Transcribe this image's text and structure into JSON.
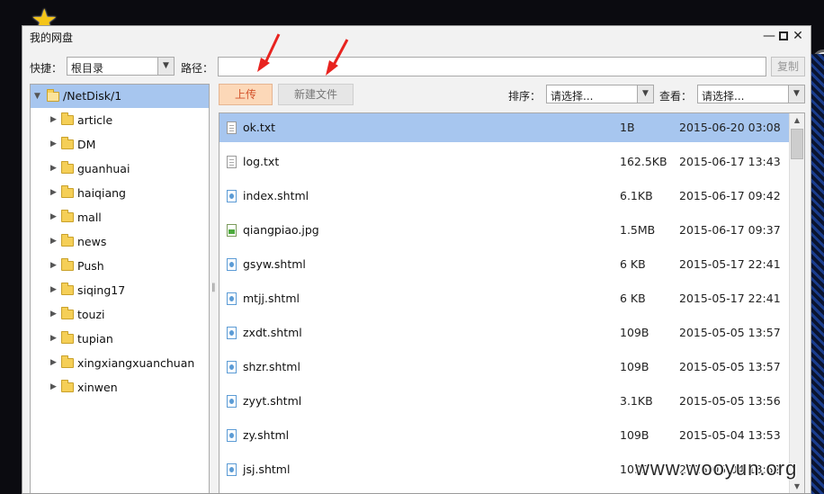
{
  "window": {
    "title": "我的网盘",
    "min_glyph": "—",
    "close_glyph": "✕"
  },
  "toolbar": {
    "quick_label": "快捷：",
    "quick_value": "根目录",
    "path_label": "路径：",
    "path_value": "",
    "copy_label": "复制",
    "upload_label": "上传",
    "newfile_label": "新建文件",
    "sort_label": "排序：",
    "sort_value": "请选择...",
    "view_label": "查看：",
    "view_value": "请选择..."
  },
  "tree": {
    "root": "/NetDisk/1",
    "children": [
      "article",
      "DM",
      "guanhuai",
      "haiqiang",
      "mall",
      "news",
      "Push",
      "siqing17",
      "touzi",
      "tupian",
      "xingxiangxuanchuan",
      "xinwen"
    ]
  },
  "files": [
    {
      "name": "ok.txt",
      "size": "1B",
      "date": "2015-06-20 03:08",
      "type": "text",
      "selected": true
    },
    {
      "name": "log.txt",
      "size": "162.5KB",
      "date": "2015-06-17 13:43",
      "type": "text"
    },
    {
      "name": "index.shtml",
      "size": "6.1KB",
      "date": "2015-06-17 09:42",
      "type": "html"
    },
    {
      "name": "qiangpiao.jpg",
      "size": "1.5MB",
      "date": "2015-06-17 09:37",
      "type": "image"
    },
    {
      "name": "gsyw.shtml",
      "size": "6 KB",
      "date": "2015-05-17 22:41",
      "type": "html"
    },
    {
      "name": "mtjj.shtml",
      "size": "6 KB",
      "date": "2015-05-17 22:41",
      "type": "html"
    },
    {
      "name": "zxdt.shtml",
      "size": "109B",
      "date": "2015-05-05 13:57",
      "type": "html"
    },
    {
      "name": "shzr.shtml",
      "size": "109B",
      "date": "2015-05-05 13:57",
      "type": "html"
    },
    {
      "name": "zyyt.shtml",
      "size": "3.1KB",
      "date": "2015-05-05 13:56",
      "type": "html"
    },
    {
      "name": "zy.shtml",
      "size": "109B",
      "date": "2015-05-04 13:53",
      "type": "html"
    },
    {
      "name": "jsj.shtml",
      "size": "109B",
      "date": "2015-05-04 13:52",
      "type": "html"
    }
  ],
  "watermark": "www.wooyun.org",
  "colors": {
    "selection": "#a7c6ef",
    "upload_bg": "#fcd8b8",
    "upload_text": "#d3522a",
    "annotation_arrow": "#e8231f"
  }
}
